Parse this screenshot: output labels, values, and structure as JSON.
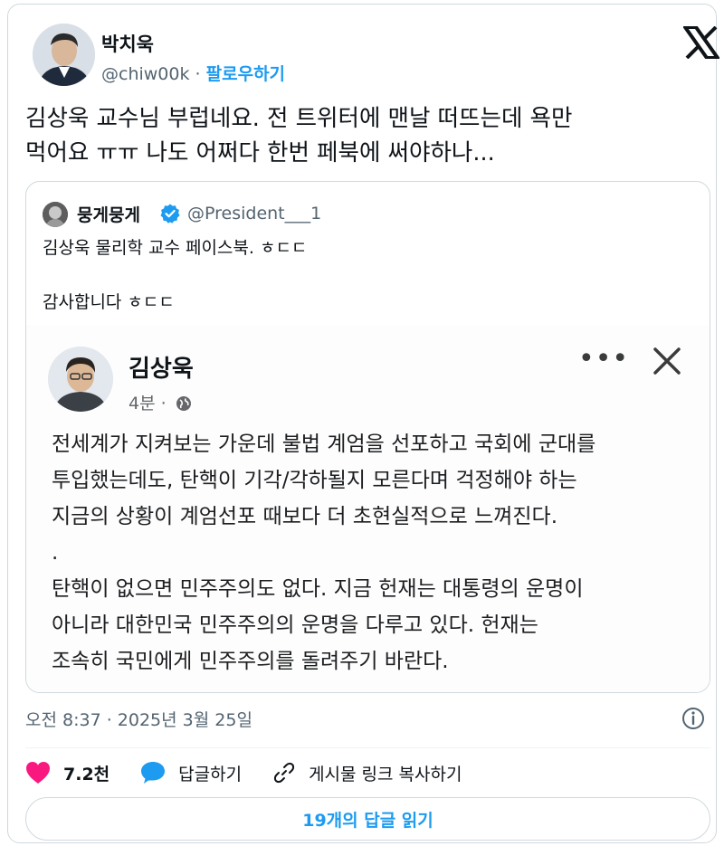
{
  "author": {
    "name": "박치욱",
    "handle": "@chiw00k",
    "separator": "·",
    "follow_label": "팔로우하기"
  },
  "tweet": {
    "text_line1": "김상욱 교수님 부럽네요. 전 트위터에 맨날 떠뜨는데 욕만",
    "text_line2": "먹어요 ㅠㅠ 나도 어쩌다 한번 페북에 써야하나..."
  },
  "quoted": {
    "name": "뭉게뭉게",
    "handle": "@President___1",
    "line1": "김상욱 물리학 교수 페이스북. ㅎㄷㄷ",
    "line2": "감사합니다 ㅎㄷㄷ",
    "facebook_post": {
      "name": "김상욱",
      "time": "4분 ·",
      "dots": "•••",
      "paragraph1": [
        "전세계가 지켜보는 가운데 불법 계엄을 선포하고 국회에 군대를",
        "투입했는데도, 탄핵이 기각/각하될지 모른다며 걱정해야 하는",
        "지금의 상황이 계엄선포 때보다 더 초현실적으로 느껴진다."
      ],
      "separator": ".",
      "paragraph2": [
        "탄핵이 없으면 민주주의도 없다. 지금 헌재는 대통령의 운명이",
        "아니라 대한민국 민주주의의 운명을 다루고 있다. 헌재는",
        "조속히 국민에게 민주주의를 돌려주기 바란다."
      ]
    }
  },
  "footer": {
    "timestamp": "오전 8:37 · 2025년 3월 25일",
    "likes": "7.2천",
    "reply_label": "답글하기",
    "copy_link_label": "게시물 링크 복사하기",
    "read_replies_label": "19개의 답글 읽기"
  },
  "colors": {
    "accent": "#1d9bf0",
    "like": "#f91880",
    "muted": "#536471",
    "border": "#cfd9de"
  },
  "icons": [
    "x-logo-icon",
    "verified-badge-icon",
    "globe-icon",
    "close-icon",
    "more-icon",
    "info-icon",
    "heart-icon",
    "reply-bubble-icon",
    "link-icon"
  ]
}
